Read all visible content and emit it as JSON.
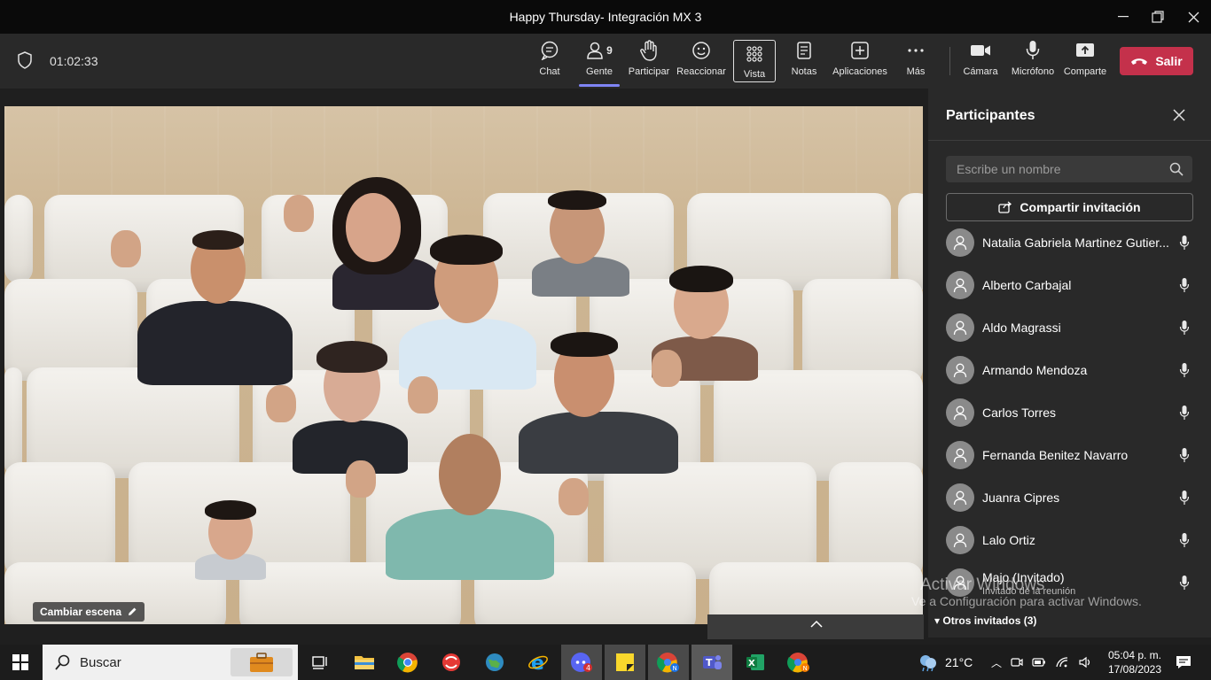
{
  "window": {
    "title": "Happy Thursday- Integración MX 3"
  },
  "toolbar": {
    "timer": "01:02:33",
    "people_count": "9",
    "buttons": {
      "chat": "Chat",
      "gente": "Gente",
      "participar": "Participar",
      "reaccionar": "Reaccionar",
      "vista": "Vista",
      "notas": "Notas",
      "aplicaciones": "Aplicaciones",
      "mas": "Más",
      "camara": "Cámara",
      "microfono": "Micrófono",
      "comparte": "Comparte"
    },
    "leave_label": "Salir",
    "leave_color": "#c4314b"
  },
  "stage": {
    "change_scene_label": "Cambiar escena"
  },
  "panel": {
    "title": "Participantes",
    "search_placeholder": "Escribe un nombre",
    "share_invite_label": "Compartir invitación",
    "participants": [
      {
        "name": "Natalia Gabriela Martinez Gutier...",
        "sub": ""
      },
      {
        "name": "Alberto Carbajal",
        "sub": ""
      },
      {
        "name": "Aldo Magrassi",
        "sub": ""
      },
      {
        "name": "Armando Mendoza",
        "sub": ""
      },
      {
        "name": "Carlos Torres",
        "sub": ""
      },
      {
        "name": "Fernanda Benitez Navarro",
        "sub": ""
      },
      {
        "name": "Juanra Cipres",
        "sub": ""
      },
      {
        "name": "Lalo Ortiz",
        "sub": ""
      },
      {
        "name": "Majo (Invitado)",
        "sub": "Invitado de la reunión"
      }
    ],
    "others_label": "Otros invitados (3)"
  },
  "watermark": {
    "line1": "Activar Windows",
    "line2": "Ve a Configuración para activar Windows."
  },
  "taskbar": {
    "search_label": "Buscar",
    "weather": "21°C",
    "time": "05:04 p. m.",
    "date": "17/08/2023"
  }
}
